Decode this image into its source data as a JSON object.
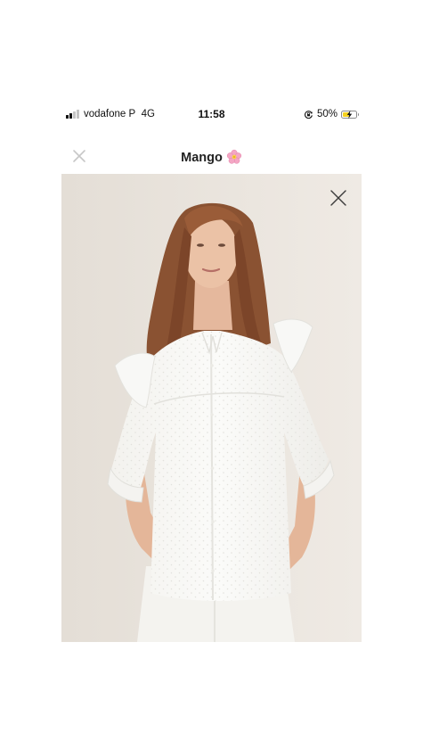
{
  "status_bar": {
    "carrier": "vodafone P",
    "network": "4G",
    "time": "11:58",
    "battery_percent": "50%",
    "battery_level": 0.5,
    "icons": [
      "signal-icon",
      "rotation-lock-icon",
      "battery-charging-icon"
    ]
  },
  "nav": {
    "title": "Mango",
    "title_emoji": "cherry-blossom-icon",
    "close_icon": "close-icon"
  },
  "product_image": {
    "description_icon": "product-photo",
    "close_icon": "close-icon"
  },
  "colors": {
    "background": "#ffffff",
    "photo_background": "#e9e4de",
    "battery_fill": "#f5d21f"
  }
}
